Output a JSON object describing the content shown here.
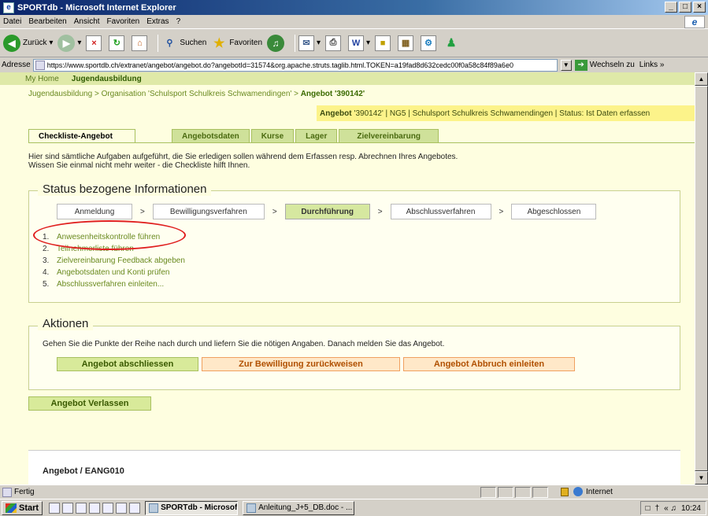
{
  "window": {
    "title": "SPORTdb - Microsoft Internet Explorer",
    "min": "_",
    "max": "□",
    "close": "×"
  },
  "menu": [
    "Datei",
    "Bearbeiten",
    "Ansicht",
    "Favoriten",
    "Extras",
    "?"
  ],
  "toolbar": {
    "back": "Zurück",
    "search": "Suchen",
    "favorites": "Favoriten"
  },
  "address": {
    "label": "Adresse",
    "url": "https://www.sportdb.ch/extranet/angebot/angebot.do?angebotId=31574&org.apache.struts.taglib.html.TOKEN=a19fad8d632cedc00f0a58c84f89a6e0",
    "go": "Wechseln zu",
    "links": "Links »"
  },
  "topnav": [
    "My Home",
    "Jugendausbildung"
  ],
  "breadcrumb": {
    "part1": "Jugendausbildung > Organisation 'Schulsport Schulkreis Schwamendingen' > ",
    "current": "Angebot '390142'"
  },
  "infobar": {
    "label": "Angebot",
    "text": "'390142' | NG5 | Schulsport Schulkreis Schwamendingen | Status: Ist Daten erfassen"
  },
  "tabs": {
    "active": "Checkliste-Angebot",
    "others": [
      "Angebotsdaten",
      "Kurse",
      "Lager",
      "Zielvereinbarung"
    ]
  },
  "intro": {
    "line1": "Hier sind sämtliche Aufgaben aufgeführt, die Sie erledigen sollen während dem Erfassen resp. Abrechnen Ihres Angebotes.",
    "line2": "Wissen Sie einmal nicht mehr weiter - die Checkliste hilft Ihnen."
  },
  "status_section": {
    "legend": "Status bezogene Informationen",
    "steps": [
      "Anmeldung",
      "Bewilligungsverfahren",
      "Durchführung",
      "Abschlussverfahren",
      "Abgeschlossen"
    ],
    "separator": ">",
    "current_step": "Durchführung",
    "tasks": [
      {
        "num": "1.",
        "label": "Anwesenheitskontrolle führen"
      },
      {
        "num": "2.",
        "label": "Teilnehmerliste führen"
      },
      {
        "num": "3.",
        "label": "Zielvereinbarung Feedback abgeben"
      },
      {
        "num": "4.",
        "label": "Angebotsdaten und Konti prüfen"
      },
      {
        "num": "5.",
        "label": "Abschlussverfahren einleiten..."
      }
    ]
  },
  "actions": {
    "legend": "Aktionen",
    "text": "Gehen Sie die Punkte der Reihe nach durch und liefern Sie die nötigen Angaben. Danach melden Sie das Angebot.",
    "btn_close": "Angebot abschliessen",
    "btn_reject": "Zur Bewilligung zurückweisen",
    "btn_abort": "Angebot Abbruch einleiten"
  },
  "leave_button": "Angebot Verlassen",
  "footer": "Angebot / EANG010",
  "statusbar": {
    "left": "Fertig",
    "zone": "Internet"
  },
  "taskbar": {
    "start": "Start",
    "item1": "SPORTdb - Microsoft I...",
    "item2": "Anleitung_J+5_DB.doc - ...",
    "clock": "10:24"
  }
}
